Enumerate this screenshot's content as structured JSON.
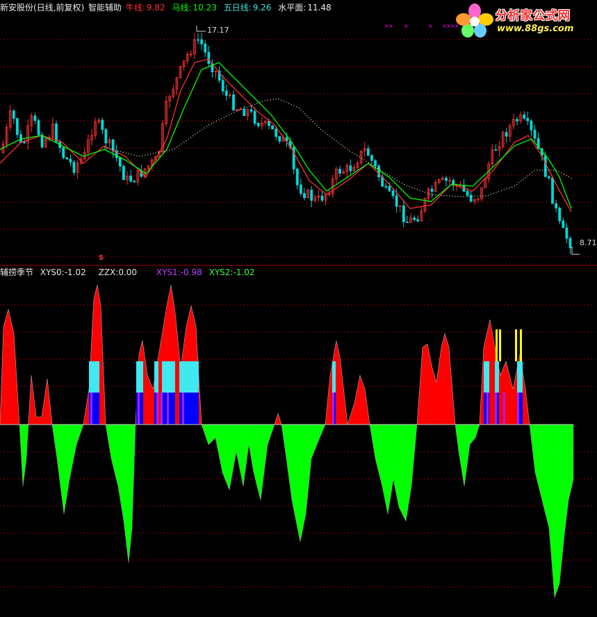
{
  "header": {
    "stock_name": "新安股份(日线,前复权)",
    "indicator_name": "智能辅助",
    "ma1_label": "牛线:",
    "ma1_value": "9.82",
    "ma2_label": "马线:",
    "ma2_value": "10.23",
    "ma3_label": "五日线:",
    "ma3_value": "9.26",
    "level_label": "水平面:",
    "level_value": "11.48"
  },
  "subheader": {
    "indicator_name": "辅捞季节",
    "xys0_label": "XYS0:",
    "xys0_value": "-1.02",
    "zzx_label": "ZZX:",
    "zzx_value": "0.00",
    "xys1_label": "XYS1:",
    "xys1_value": "-0.98",
    "xys2_label": "XYS2:",
    "xys2_value": "-1.02"
  },
  "price_labels": {
    "high": "17.17",
    "low": "8.71"
  },
  "marker_label": "S",
  "logo": {
    "title": "分析家公式网",
    "url": "www.88gs.com"
  },
  "colors": {
    "up": "#ff3333",
    "down": "#00d8d8",
    "ma_red": "#ff3030",
    "ma_green": "#00ff00",
    "ma_dotted": "#f0f0c0",
    "hist_pos": "#ff0000",
    "hist_neg": "#00ff00",
    "cyan_band": "#40e8f0",
    "blue_band": "#0000ff",
    "purple_bar": "#a020ff",
    "yellow_bar": "#ffff00",
    "grid": "#8b0000",
    "magenta": "#ff00ff"
  },
  "chart_data": {
    "type": "line",
    "title": "",
    "series": [
      {
        "name": "牛线",
        "values": [
          9.82
        ]
      },
      {
        "name": "马线",
        "values": [
          10.23
        ]
      },
      {
        "name": "五日线",
        "values": [
          9.26
        ]
      }
    ],
    "ylim": [
      8.71,
      17.17
    ]
  }
}
